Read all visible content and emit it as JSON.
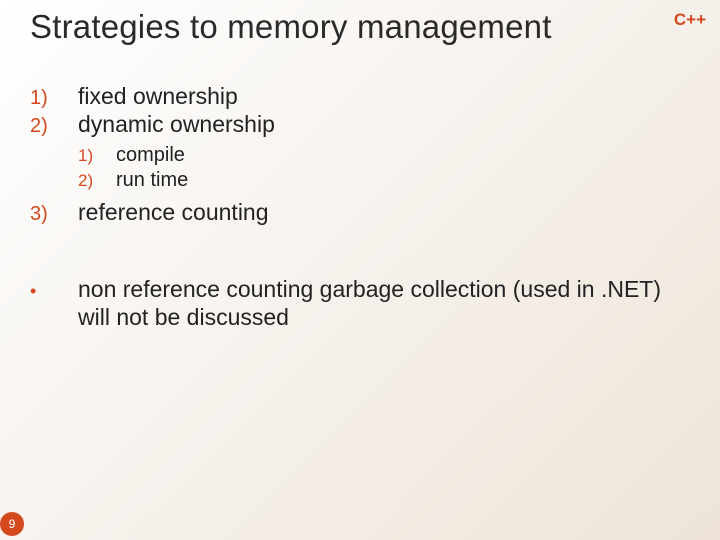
{
  "title": "Strategies to memory management",
  "brand": "C++",
  "items": {
    "m1": "1)",
    "t1": "fixed ownership",
    "m2": "2)",
    "t2": "dynamic ownership",
    "sub": {
      "m1": "1)",
      "t1": "compile",
      "m2": "2)",
      "t2": "run time"
    },
    "m3": "3)",
    "t3": "reference counting",
    "bullet": "•",
    "note": "non reference counting garbage collection (used in .NET) will not be discussed"
  },
  "page_number": "9"
}
